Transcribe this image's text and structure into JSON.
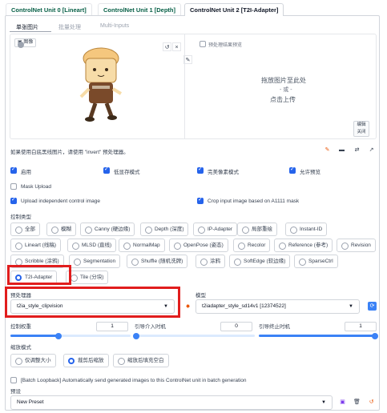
{
  "tabs": [
    {
      "label": "ControlNet Unit 0 [Lineart]"
    },
    {
      "label": "ControlNet Unit 1 [Depth]"
    },
    {
      "label": "ControlNet Unit 2 [T2I-Adapter]"
    }
  ],
  "subtabs": [
    "单张图片",
    "批量处理",
    "Multi-Inputs"
  ],
  "image_panel": {
    "image_label": "图像",
    "preview_toggle": "预处理结果预览",
    "drop_line1": "拖放图片至此处",
    "drop_line2": "- 或 -",
    "drop_line3": "点击上传",
    "edit_label": "编辑",
    "close_label": "关闭"
  },
  "hint": "如果使用白底黑线图片，请使用 \"invert\" 预处理器。",
  "options": {
    "enable": "启用",
    "low_vram": "低显存模式",
    "pixel_perfect": "完美像素模式",
    "allow_preview": "允许预览",
    "mask_upload": "Mask Upload",
    "independent_image": "Upload independent control image",
    "crop_input": "Crop input image based on A1111 mask"
  },
  "control_type": {
    "label": "控制类型",
    "row1": [
      "全部",
      "模糊",
      "Canny (硬边缘)",
      "Depth (深度)",
      "IP-Adapter",
      "局部重绘",
      "Instant-ID"
    ],
    "row2": [
      "Lineart (线稿)",
      "MLSD (直线)",
      "NormalMap",
      "OpenPose (姿态)",
      "Recolor",
      "Reference (参考)",
      "Revision"
    ],
    "row3": [
      "Scribble (涂鸦)",
      "Segmentation",
      "Shuffle (随机洗牌)",
      "涂鸦",
      "SoftEdge (软边缘)",
      "SparseCtrl"
    ],
    "row4": [
      "T2I-Adapter",
      "Tile (分块)"
    ],
    "selected": "T2I-Adapter"
  },
  "preprocessor": {
    "label": "预处理器",
    "value": "t2ia_style_clipvision"
  },
  "model": {
    "label": "模型",
    "value": "t2iadapter_style_sd14v1 [12374522]"
  },
  "sliders": {
    "weight": {
      "label": "控制权重",
      "value": "1"
    },
    "start": {
      "label": "引导介入时机",
      "value": "0"
    },
    "end": {
      "label": "引导终止时机",
      "value": "1"
    }
  },
  "resize_mode": {
    "label": "缩放模式",
    "options": [
      "仅调整大小",
      "裁剪后缩放",
      "缩放后填充空白"
    ],
    "selected": "裁剪后缩放"
  },
  "batch_loopback": "[Batch Loopback] Automatically send generated images to this ControlNet unit in batch generation",
  "preset": {
    "label": "预设",
    "value": "New Preset"
  },
  "colors": {
    "accent": "#2563eb",
    "highlight": "#e11d1d",
    "tab_text": "#065f46"
  }
}
